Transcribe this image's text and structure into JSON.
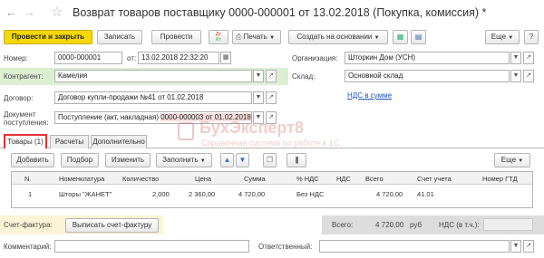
{
  "window": {
    "title": "Возврат товаров поставщику 0000-000001 от 13.02.2018 (Покупка, комиссия) *"
  },
  "toolbar": {
    "post_close": "Провести и закрыть",
    "save": "Записать",
    "post": "Провести",
    "dt_kt": "Дт\nКт",
    "print": "Печать",
    "create_based": "Создать на основании",
    "more": "Еще",
    "help": "?"
  },
  "header": {
    "number_label": "Номер:",
    "number_value": "0000-000001",
    "date_label": "от:",
    "date_value": "13.02.2018 22:32:20",
    "org_label": "Организация:",
    "org_value": "Шторкин Дом (УСН)",
    "counterparty_label": "Контрагент:",
    "counterparty_value": "Камелия",
    "warehouse_label": "Склад:",
    "warehouse_value": "Основной склад",
    "vat_link": "НДС в сумме",
    "contract_label": "Договор:",
    "contract_value": "Договор купли-продажи №41 от 01.02.2018",
    "receipt_label_1": "Документ",
    "receipt_label_2": "поступления:",
    "receipt_value_a": "Поступление (акт, накладная) ",
    "receipt_value_b": "0000-000003 от 01.02.2018"
  },
  "watermark": {
    "title": "БухЭксперт8",
    "subtitle": "Справочная система по работе в 1С"
  },
  "tabs": [
    {
      "label": "Товары (1)"
    },
    {
      "label": "Расчеты"
    },
    {
      "label": "Дополнительно"
    }
  ],
  "table_toolbar": {
    "add": "Добавить",
    "select": "Подбор",
    "change": "Изменить",
    "fill": "Заполнить",
    "more": "Еще"
  },
  "table": {
    "columns": [
      "N",
      "Номенклатура",
      "Количество",
      "Цена",
      "Сумма",
      "% НДС",
      "НДС",
      "Всего",
      "Счет учета",
      "Номер ГТД"
    ],
    "rows": [
      {
        "n": "1",
        "item": "Шторы \"ЖАНЕТ\"",
        "qty": "2,000",
        "price": "2 360,00",
        "sum": "4 720,00",
        "vat_rate": "Без НДС",
        "vat": "",
        "total": "4 720,00",
        "account": "41.01",
        "gtd": ""
      }
    ]
  },
  "footer": {
    "invoice_label": "Счет-фактура:",
    "invoice_button": "Выписать счет-фактуру",
    "total_label": "Всего:",
    "total_value": "4 720,00",
    "currency": "руб",
    "vat_label": "НДС (в т.ч.):",
    "vat_value": "",
    "comment_label": "Комментарий:",
    "comment_value": "",
    "responsible_label": "Ответственный:",
    "responsible_value": ""
  }
}
